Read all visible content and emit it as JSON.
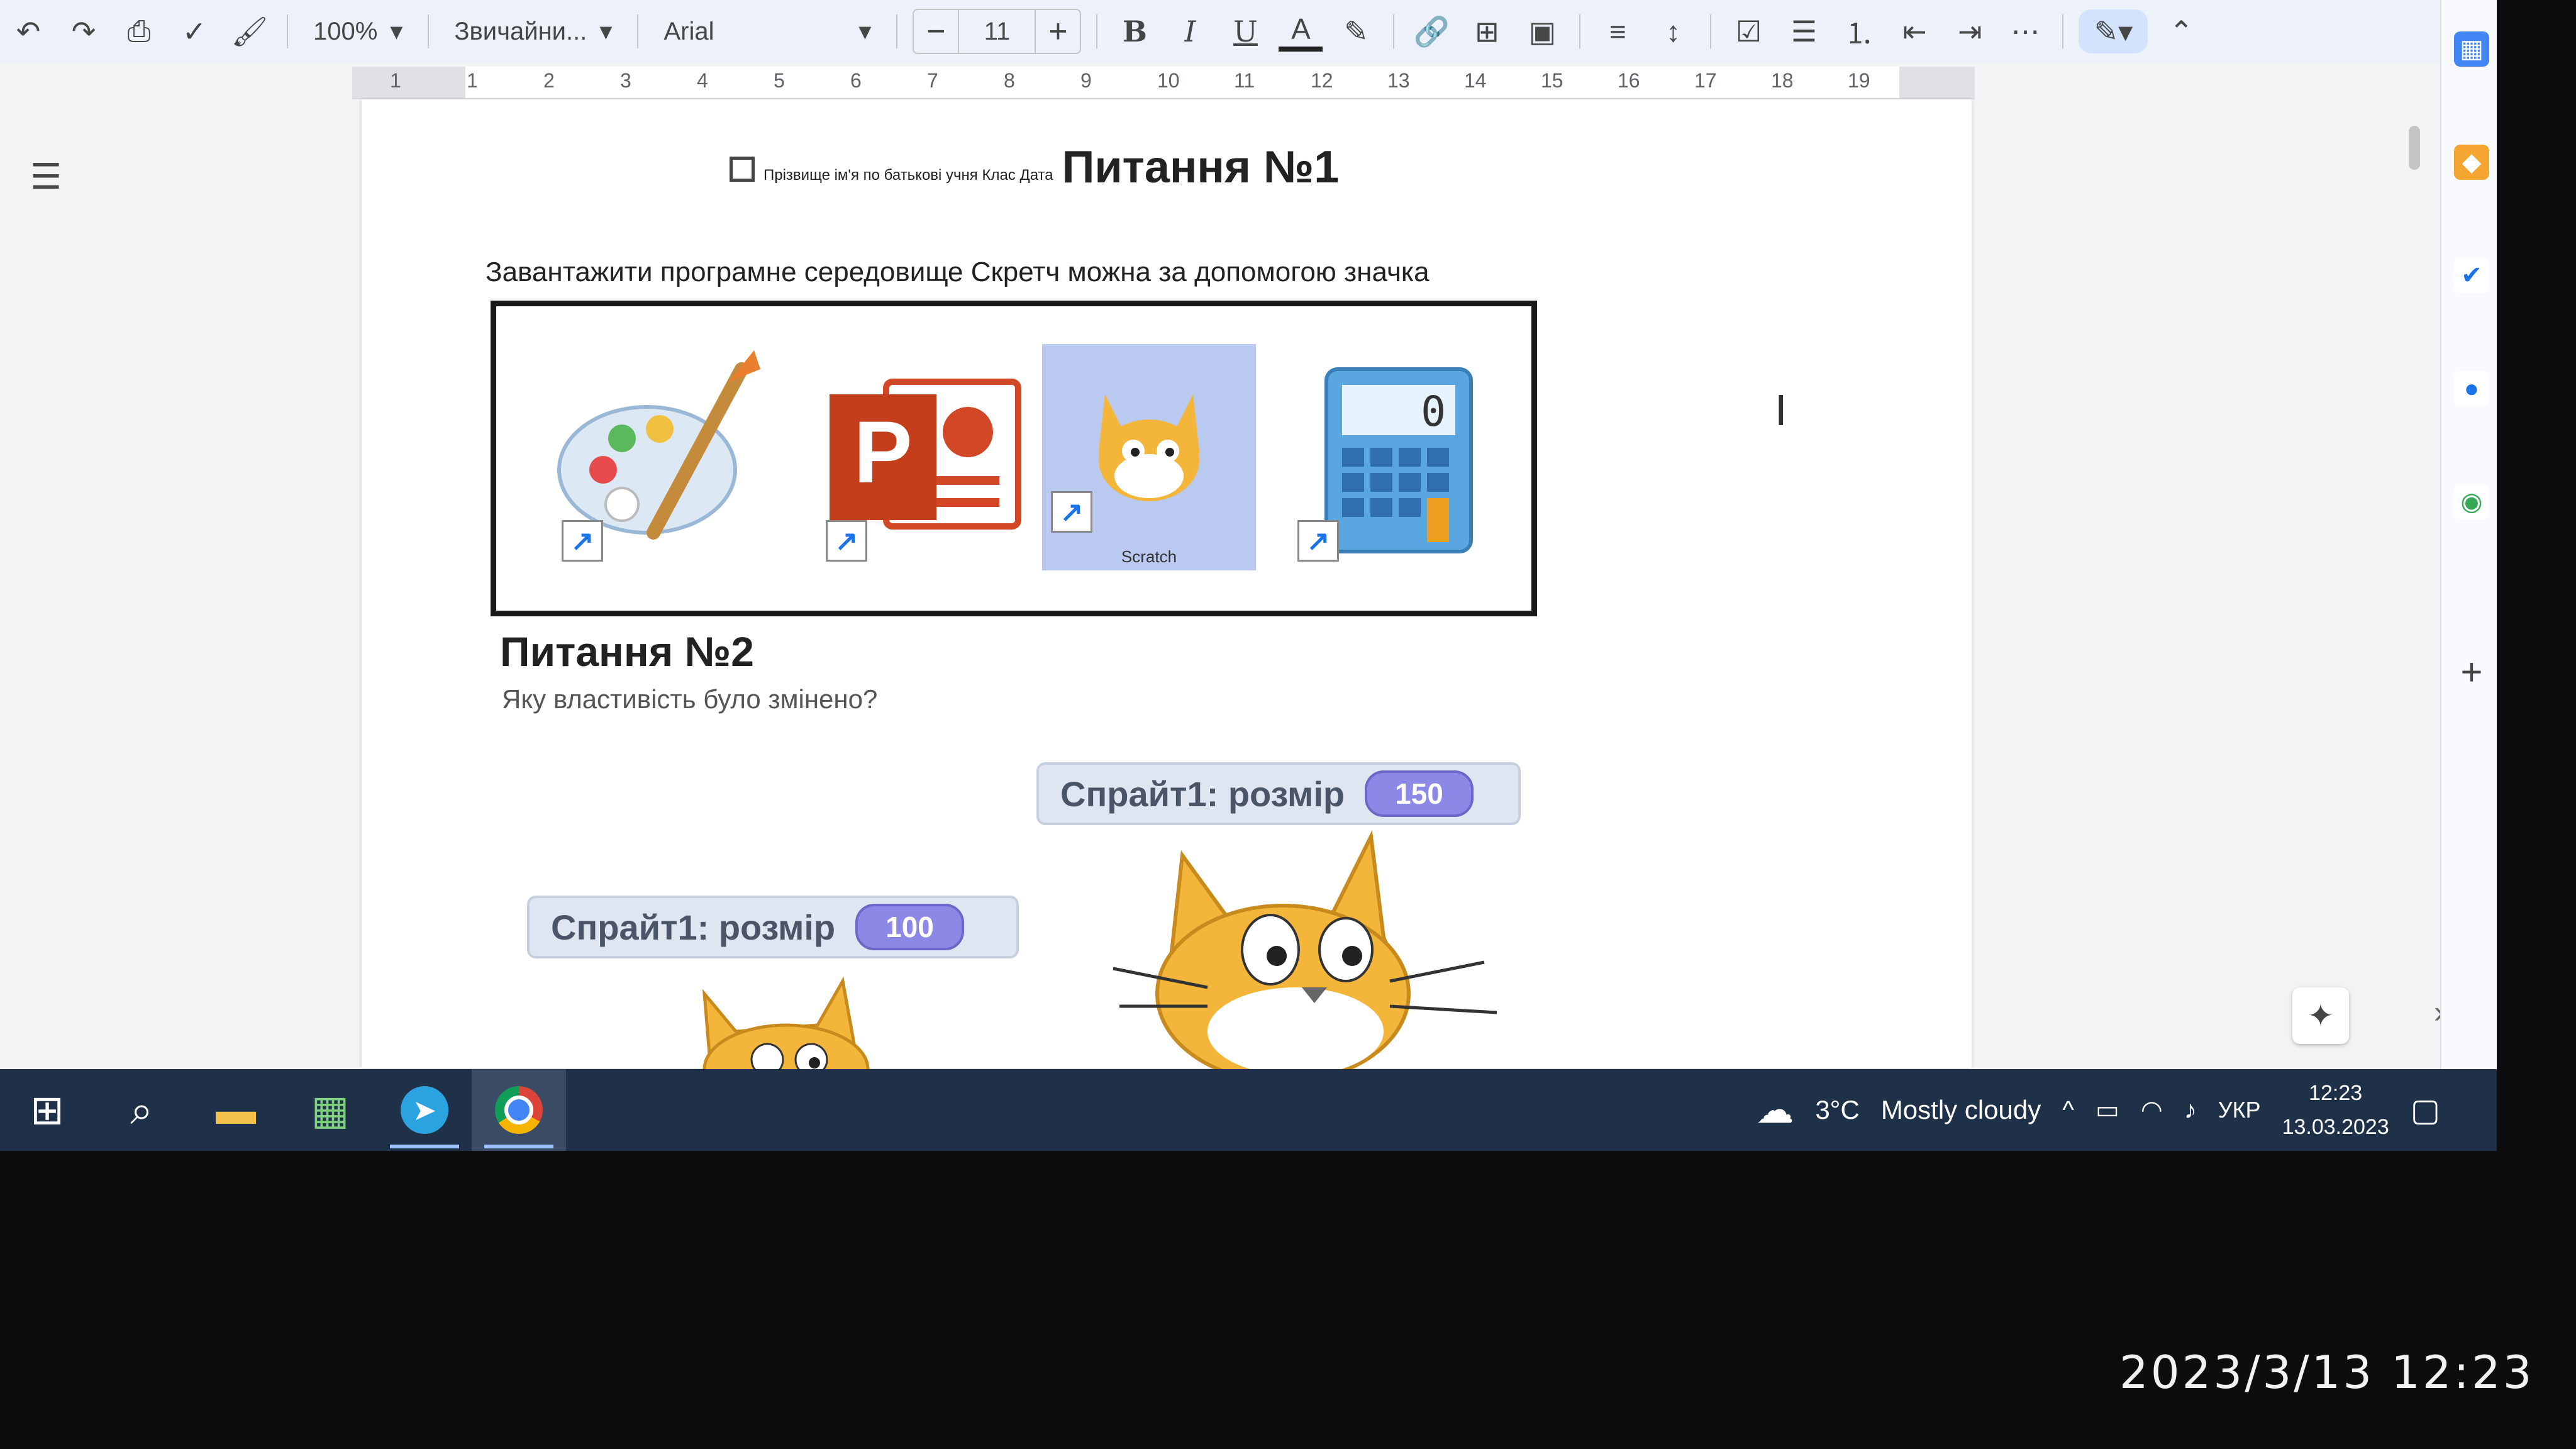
{
  "toolbar": {
    "zoom": "100%",
    "style": "Звичайни...",
    "font": "Arial",
    "font_size": "11",
    "bold": "B",
    "italic": "I",
    "underline": "U",
    "text_color": "A",
    "more": "⋯"
  },
  "ruler": {
    "numbers": [
      "1",
      "1",
      "2",
      "3",
      "4",
      "5",
      "6",
      "7",
      "8",
      "9",
      "10",
      "11",
      "12",
      "13",
      "14",
      "15",
      "16",
      "17",
      "18",
      "19"
    ]
  },
  "document": {
    "header_small": "Прізвище ім'я по батькові учня Клас Дата",
    "q1_title": "Питання №1",
    "q1_text": "Завантажити програмне середовище Скретч можна за допомогою значка",
    "scratch_caption": "Scratch",
    "q2_title": "Питання №2",
    "q2_text": "Яку властивість було змінено?",
    "sprite_label": "Спрайт1: розмір",
    "sprite_value_a": "150",
    "sprite_value_b": "100"
  },
  "taskbar": {
    "weather_temp": "3°C",
    "weather_text": "Mostly cloudy",
    "language": "УКР",
    "time": "12:23",
    "date": "13.03.2023"
  },
  "photo_timestamp": "2023/3/13 12:23",
  "colors": {
    "toolbar_bg": "#edf2fa",
    "taskbar_bg": "#1f3148",
    "scratch_orange": "#f4b63a",
    "scratch_value": "#8c88e6"
  }
}
